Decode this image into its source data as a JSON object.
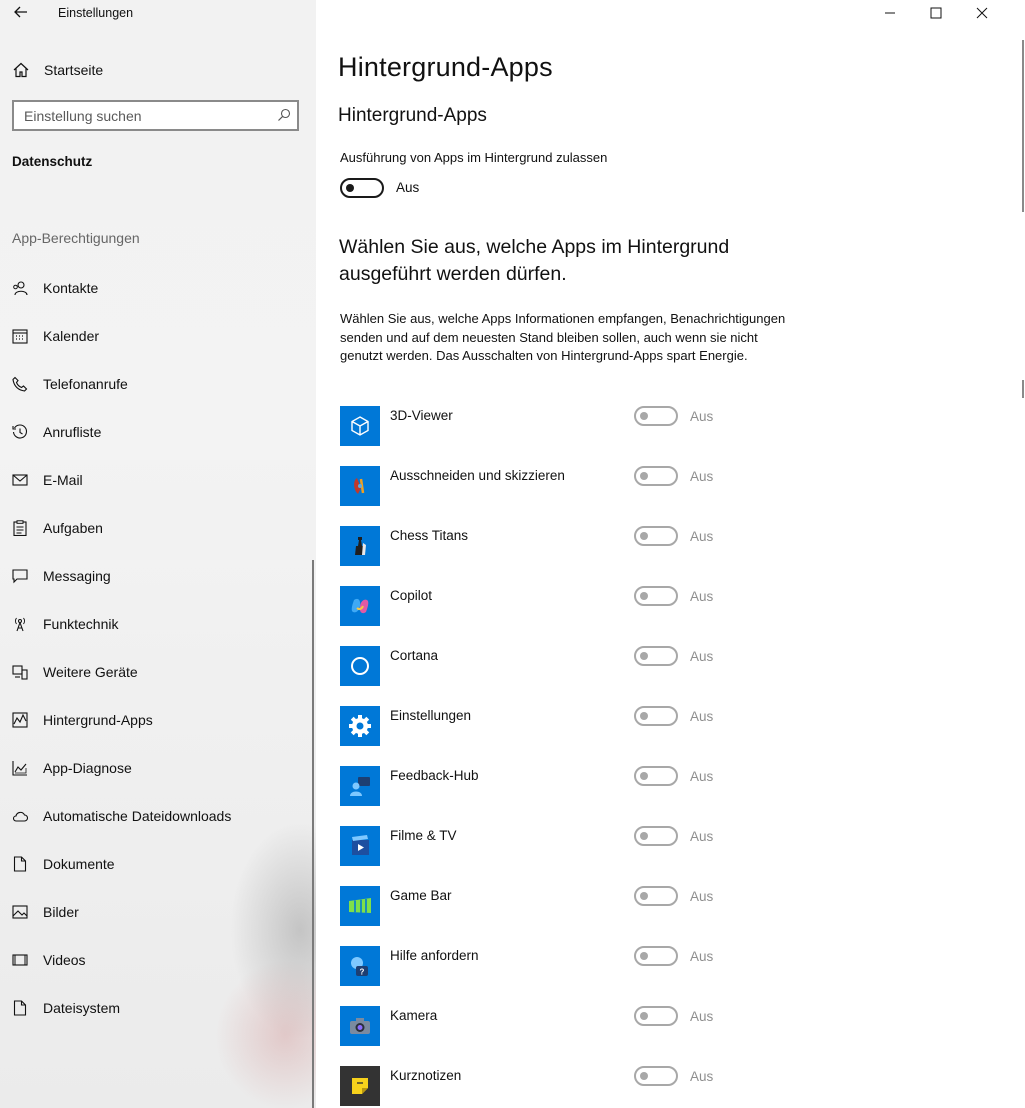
{
  "window": {
    "title": "Einstellungen"
  },
  "sidebar": {
    "home_label": "Startseite",
    "search_placeholder": "Einstellung suchen",
    "section": "Datenschutz",
    "group_title": "App-Berechtigungen",
    "items": [
      {
        "label": "Kontakte",
        "icon": "contacts-icon"
      },
      {
        "label": "Kalender",
        "icon": "calendar-icon"
      },
      {
        "label": "Telefonanrufe",
        "icon": "phone-icon"
      },
      {
        "label": "Anrufliste",
        "icon": "history-icon"
      },
      {
        "label": "E-Mail",
        "icon": "mail-icon"
      },
      {
        "label": "Aufgaben",
        "icon": "tasks-icon"
      },
      {
        "label": "Messaging",
        "icon": "chat-icon"
      },
      {
        "label": "Funktechnik",
        "icon": "radio-icon"
      },
      {
        "label": "Weitere Geräte",
        "icon": "devices-icon"
      },
      {
        "label": "Hintergrund-Apps",
        "icon": "background-apps-icon"
      },
      {
        "label": "App-Diagnose",
        "icon": "diagnostics-icon"
      },
      {
        "label": "Automatische Dateidownloads",
        "icon": "cloud-icon"
      },
      {
        "label": "Dokumente",
        "icon": "document-icon"
      },
      {
        "label": "Bilder",
        "icon": "pictures-icon"
      },
      {
        "label": "Videos",
        "icon": "video-icon"
      },
      {
        "label": "Dateisystem",
        "icon": "filesystem-icon"
      }
    ]
  },
  "main": {
    "page_title": "Hintergrund-Apps",
    "section_title": "Hintergrund-Apps",
    "allow_label": "Ausführung von Apps im Hintergrund zulassen",
    "allow_state": "Aus",
    "choose_heading": "Wählen Sie aus, welche Apps im Hintergrund ausgeführt werden dürfen.",
    "description": "Wählen Sie aus, welche Apps Informationen empfangen, Benachrichtigungen senden und auf dem neuesten Stand bleiben sollen, auch wenn sie nicht genutzt werden. Das Ausschalten von Hintergrund-Apps spart Energie.",
    "apps": [
      {
        "name": "3D-Viewer",
        "state": "Aus",
        "icon": "cube-icon",
        "tile_color": "#0078d7"
      },
      {
        "name": "Ausschneiden und skizzieren",
        "state": "Aus",
        "icon": "snip-sketch-icon",
        "tile_color": "#0078d7"
      },
      {
        "name": "Chess Titans",
        "state": "Aus",
        "icon": "chess-icon",
        "tile_color": "#0078d7"
      },
      {
        "name": "Copilot",
        "state": "Aus",
        "icon": "copilot-icon",
        "tile_color": "#0078d7"
      },
      {
        "name": "Cortana",
        "state": "Aus",
        "icon": "cortana-icon",
        "tile_color": "#0078d7"
      },
      {
        "name": "Einstellungen",
        "state": "Aus",
        "icon": "gear-icon",
        "tile_color": "#0078d7"
      },
      {
        "name": "Feedback-Hub",
        "state": "Aus",
        "icon": "feedback-icon",
        "tile_color": "#0078d7"
      },
      {
        "name": "Filme & TV",
        "state": "Aus",
        "icon": "movies-icon",
        "tile_color": "#0078d7"
      },
      {
        "name": "Game Bar",
        "state": "Aus",
        "icon": "gamebar-icon",
        "tile_color": "#0078d7"
      },
      {
        "name": "Hilfe anfordern",
        "state": "Aus",
        "icon": "help-icon",
        "tile_color": "#0078d7"
      },
      {
        "name": "Kamera",
        "state": "Aus",
        "icon": "camera-icon",
        "tile_color": "#0078d7"
      },
      {
        "name": "Kurznotizen",
        "state": "Aus",
        "icon": "sticky-notes-icon",
        "tile_color": "#333333"
      }
    ]
  }
}
